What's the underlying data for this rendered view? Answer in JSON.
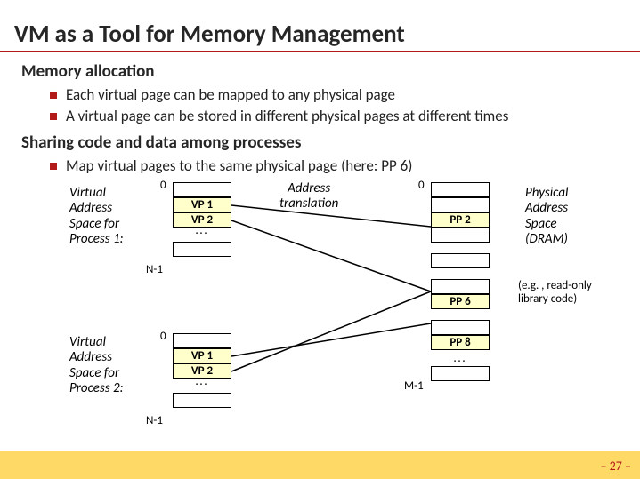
{
  "title": "VM as a Tool for Memory Management",
  "section1": {
    "heading": "Memory allocation",
    "bullets": [
      "Each virtual page can be mapped to any physical page",
      "A virtual page can be stored in different physical pages at different times"
    ]
  },
  "section2": {
    "heading": "Sharing code and data among processes",
    "bullets": [
      "Map virtual pages to the same physical page (here: PP 6)"
    ]
  },
  "diagram": {
    "vas1_label_l1": "Virtual",
    "vas1_label_l2": "Address",
    "vas1_label_l3": "Space for",
    "vas1_label_l4": "Process 1:",
    "vas2_label_l1": "Virtual",
    "vas2_label_l2": "Address",
    "vas2_label_l3": "Space for",
    "vas2_label_l4": "Process 2:",
    "pas_label_l1": "Physical",
    "pas_label_l2": "Address",
    "pas_label_l3": "Space",
    "pas_label_l4": "(DRAM)",
    "addr_trans_l1": "Address",
    "addr_trans_l2": "translation",
    "eg_l1": "(e.g. , read-only",
    "eg_l2": "library code)",
    "vp1": "VP 1",
    "vp2": "VP 2",
    "pp2": "PP 2",
    "pp6": "PP 6",
    "pp8": "PP 8",
    "zero": "0",
    "n1": "N-1",
    "m1": "M-1",
    "dots": "..."
  },
  "pagenum": "– 27 –"
}
